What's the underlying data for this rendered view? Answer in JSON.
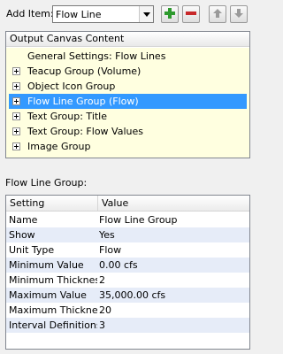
{
  "toolbar": {
    "add_item_label": "Add Item:",
    "add_item_value": "Flow Line",
    "icons": {
      "dropdown": "chevron-down-icon",
      "add": "plus-icon",
      "remove": "minus-icon",
      "up": "arrow-up-icon",
      "down": "arrow-down-icon"
    },
    "colors": {
      "add": "#2e9a2e",
      "remove": "#c8282a",
      "arrow": "#8a8a8a"
    }
  },
  "tree": {
    "header": "Output Canvas Content",
    "background": "#ffffe0",
    "selected_color": "#3399ff",
    "items": [
      {
        "label": "General Settings: Flow Lines",
        "expandable": false,
        "selected": false
      },
      {
        "label": "Teacup Group (Volume)",
        "expandable": true,
        "selected": false
      },
      {
        "label": "Object Icon Group",
        "expandable": true,
        "selected": false
      },
      {
        "label": "Flow Line Group (Flow)",
        "expandable": true,
        "selected": true
      },
      {
        "label": "Text Group: Title",
        "expandable": true,
        "selected": false
      },
      {
        "label": "Text Group: Flow Values",
        "expandable": true,
        "selected": false
      },
      {
        "label": "Image Group",
        "expandable": true,
        "selected": false
      }
    ]
  },
  "properties": {
    "title": "Flow Line Group:",
    "columns": [
      "Setting",
      "Value"
    ],
    "rows": [
      {
        "setting": "Name",
        "value": "Flow Line Group"
      },
      {
        "setting": "Show",
        "value": "Yes"
      },
      {
        "setting": "Unit Type",
        "value": "Flow"
      },
      {
        "setting": "Minimum Value",
        "value": "0.00 cfs"
      },
      {
        "setting": "Minimum Thickness",
        "value": "2"
      },
      {
        "setting": "Maximum Value",
        "value": "35,000.00 cfs"
      },
      {
        "setting": "Maximum Thickness",
        "value": "20"
      },
      {
        "setting": "Interval Definitions",
        "value": "3"
      }
    ]
  }
}
